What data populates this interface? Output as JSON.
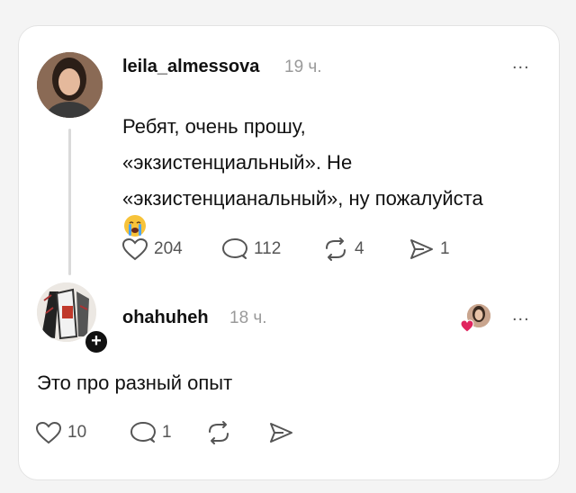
{
  "post": {
    "username": "leila_almessova",
    "time": "19 ч.",
    "more": "...",
    "lines": [
      "Ребят, очень прошу,",
      "«экзистенциальный». Не",
      "«экзистенцианальный», ну пожалуйста"
    ],
    "emoji": "loudly-crying-face",
    "stats": {
      "likes": "204",
      "comments": "112",
      "reposts": "4",
      "shares": "1"
    }
  },
  "reply": {
    "username": "ohahuheh",
    "time": "18 ч.",
    "more": "...",
    "text": "Это про разный опыт",
    "follow_badge": "+",
    "stats": {
      "likes": "10",
      "comments": "1"
    }
  },
  "colors": {
    "text": "#111111",
    "muted": "#9a9a9a",
    "icon": "#555555",
    "heart": "#e0245e"
  }
}
